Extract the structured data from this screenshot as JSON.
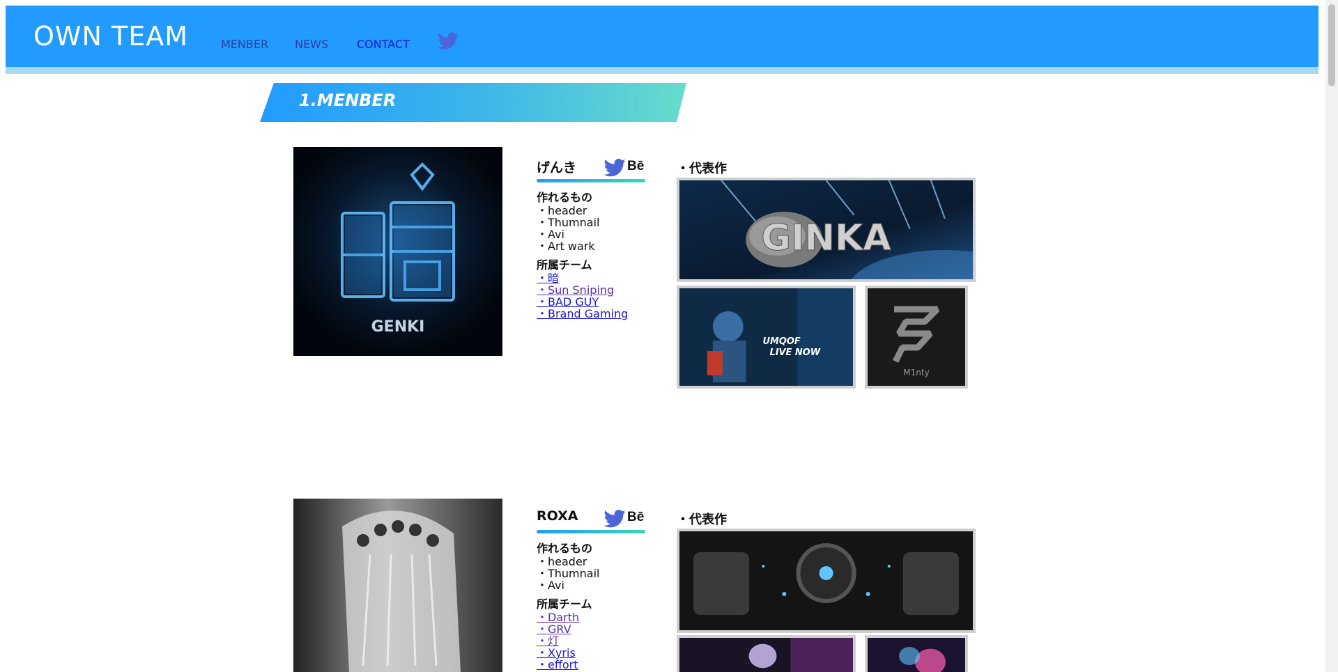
{
  "header": {
    "logo": "OWN TEAM",
    "nav": {
      "member": "MENBER",
      "news": "NEWS",
      "contact": "CONTACT"
    },
    "twitter_icon": "twitter-bird-icon",
    "bg_color": "#219bff",
    "stripe_color": "#a8d8f0"
  },
  "section": {
    "title": "1.MENBER"
  },
  "members": [
    {
      "name": "げんき",
      "avatar_text": "GENKI",
      "avatar_glyph": "暗",
      "skills_heading": "作れるもの",
      "skills": [
        "・header",
        "・Thumnail",
        "・Avi",
        "・Art wark"
      ],
      "teams_heading": "所属チーム",
      "teams": [
        "・暗",
        "・Sun Sniping",
        "・BAD GUY",
        "・Brand Gaming"
      ],
      "works_heading": "・代表作",
      "works": {
        "main_text": "GINKA",
        "second_text_1": "UMQOF",
        "second_text_2": "LIVE NOW",
        "third_text": "M1nty"
      },
      "behance_label": "Bē"
    },
    {
      "name": "ROXA",
      "skills_heading": "作れるもの",
      "skills": [
        "・header",
        "・Thumnail",
        "・Avi"
      ],
      "teams_heading": "所属チーム",
      "teams": [
        "・Darth",
        "・GRV",
        "・灯",
        "・Xyris",
        "・effort"
      ],
      "works_heading": "・代表作",
      "behance_label": "Bē"
    }
  ]
}
